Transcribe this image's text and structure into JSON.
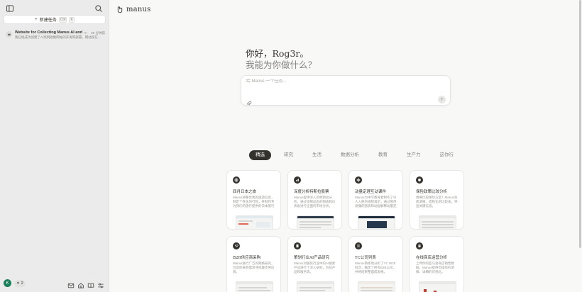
{
  "sidebar": {
    "new_task_label": "新建任务",
    "shortcut_ctrl": "Ctrl",
    "shortcut_key": "K",
    "tasks": [
      {
        "title": "Website for Collecting Manus AI and Cha...",
        "time": "20 分钟前",
        "preview": "我已经成功创建了AI案例收集网站的开发和部署，网站现在..."
      }
    ],
    "user_initial": "K",
    "credits": "2"
  },
  "main": {
    "logo_text": "manus",
    "greeting": "你好，Rog3r。",
    "greeting_sub": "我能为你做什么？",
    "input_placeholder": "给 Manus 一个任务...",
    "tabs": [
      "精选",
      "研究",
      "生活",
      "数据分析",
      "教育",
      "生产力",
      "这你行"
    ],
    "active_tab": 0,
    "cards": [
      {
        "title": "四月日本之旅",
        "desc": "Manus将整合我的旅游信息，制定个性化的行程，并制作专为我们的旅行提供的日本旅行手册。",
        "icon": "globe-icon"
      },
      {
        "title": "深度分析特斯拉股票",
        "desc": "Manus提供深入的特斯拉分析，通过绘制动态的图表和仪表板进行全面的市场分析。",
        "icon": "chart-icon"
      },
      {
        "title": "动量定理互动课件",
        "desc": "Manus为中学教育者制作了引人入胜的视频演示，通过简单易懂的图表和动画解释动量定理。",
        "icon": "atom-icon"
      },
      {
        "title": "保险政策比较分析",
        "desc": "想要比较保险方案？Manus生成清晰、结构化的比较表，突出关键信息。",
        "icon": "shield-icon"
      },
      {
        "title": "B2B供应商采购",
        "desc": "Manus进行广泛的网络研究，为您的采购需求寻找最佳供应商。",
        "icon": "handshake-icon"
      },
      {
        "title": "策划行业AI产品研究",
        "desc": "Manus对服装行业中的AI搜索产品进行了深入研究，包括产品和服务等。",
        "icon": "document-icon"
      },
      {
        "title": "YC公司列表",
        "desc": "Manus熟练地分析了YC W25批次，确定了所有B2B公司，并将结果整理成表格。",
        "icon": "list-icon"
      },
      {
        "title": "在线商店运营分析",
        "desc": "上传你的亚马逊商店销售数据，Manus提供可操作的洞察、详细的可视化。",
        "icon": "store-icon"
      }
    ]
  },
  "colors": {
    "accent": "#34322d",
    "sidebar_bg": "#ebebeb",
    "main_bg": "#f8f8f7",
    "avatar": "#1a7f5a"
  }
}
